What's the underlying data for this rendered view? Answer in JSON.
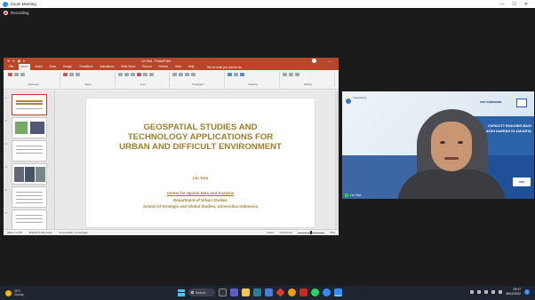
{
  "zoom": {
    "window_title": "Zoom Meeting",
    "window_controls": [
      "—",
      "☐",
      "✕"
    ],
    "recording_label": "Recording"
  },
  "ppt": {
    "doc_name": "Lin Yola - PowerPoint",
    "qat": "⟲ ⟳ ▣ ▾",
    "tabs": [
      "File",
      "Home",
      "Insert",
      "Draw",
      "Design",
      "Transitions",
      "Animations",
      "Slide Show",
      "Record",
      "Review",
      "View",
      "Help"
    ],
    "active_tab": 1,
    "tell_me": "Tell me what you want to do",
    "ribbon_groups": [
      "Clipboard",
      "Slides",
      "Font",
      "Paragraph",
      "Drawing",
      "Editing"
    ],
    "thumb_numbers": [
      "1",
      "2",
      "3",
      "4",
      "5",
      "6"
    ],
    "status_left": "Slide 1 of 20",
    "status_lang": "English (Indonesia)",
    "status_access": "Accessibility: Investigate",
    "status_notes": "Notes",
    "status_comments": "Comments",
    "status_zoom": "75%"
  },
  "slide": {
    "title_line1": "GEOSPATIAL STUDIES AND",
    "title_line2": "TECHNOLOGY APPLICATIONS FOR",
    "title_line3": "URBAN AND DIFFICULT ENVIRONMENT",
    "author": "Lin Yola",
    "aff_line1": "Center for Spatial Data and Analysis",
    "aff_line2": "Department of Urban Studies",
    "aff_line3": "School of Strategic and Global Studies, Universitas Indonesia"
  },
  "video": {
    "logo_text": "Supported by",
    "esri": "esri Indonesia",
    "caption_line1": "CAPACITY BUILDING BAGI",
    "caption_line2": "ATAH DAERAH DI JAKARTA",
    "badge": "DMS",
    "participant": "Lin Yola"
  },
  "taskbar": {
    "temp": "30°C",
    "weather": "Cloudy",
    "search": "Search",
    "time": "09:57",
    "date": "08/12/2022",
    "notif_count": "1"
  },
  "colors": {
    "ppt_accent": "#b7472a",
    "slide_gold": "#a07d2a",
    "zoom_blue": "#2d8cff"
  }
}
